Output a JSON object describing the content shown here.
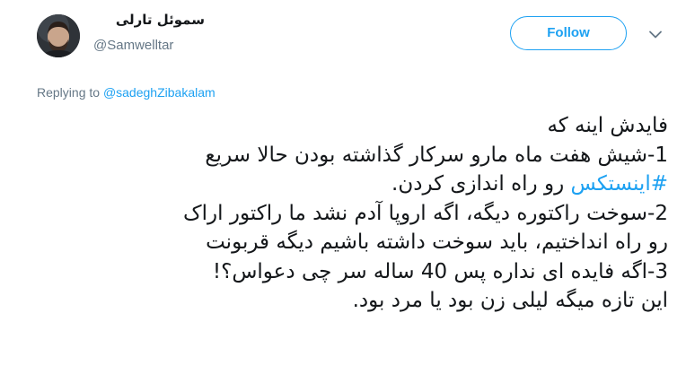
{
  "header": {
    "display_name": "سموئل تارلی",
    "handle": "@Samwelltar",
    "follow_label": "Follow",
    "avatar_icon": "avatar-portrait",
    "menu_icon": "chevron-down-icon"
  },
  "reply": {
    "prefix": "Replying to",
    "mention": "@sadeghZibakalam"
  },
  "tweet": {
    "line1": "فایدش اینه که",
    "line2": "1-شیش هفت ماه مارو سرکار گذاشته بودن حالا سریع",
    "line3_hashtag": "#اینستکس",
    "line3_rest": "رو راه اندازی کردن.",
    "line4": "2-سوخت راکتوره دیگه، اگه اروپا آدم نشد ما راکتور اراک",
    "line5": "رو راه انداختیم، باید سوخت داشته باشیم دیگه قربونت",
    "line6": "3-اگه فایده ای نداره پس 40 ساله سر چی دعواس؟!",
    "line7": "این تازه میگه لیلی زن بود یا مرد بود."
  },
  "colors": {
    "accent": "#1da1f2",
    "text": "#14171a",
    "secondary": "#657786"
  }
}
